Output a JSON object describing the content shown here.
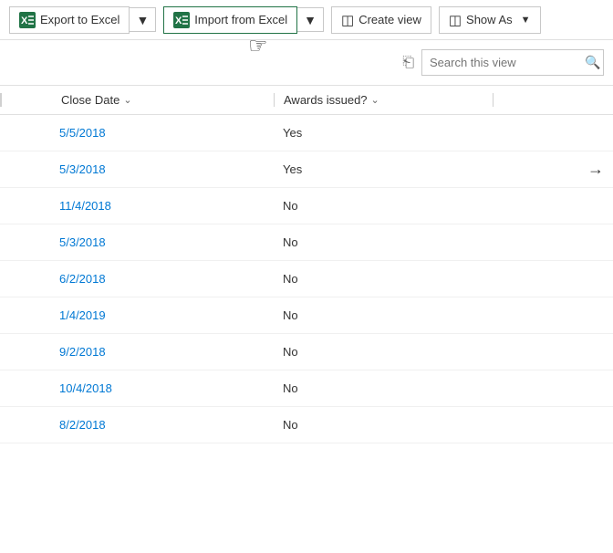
{
  "toolbar": {
    "export_label": "Export to Excel",
    "import_label": "Import from Excel",
    "create_view_label": "Create view",
    "show_as_label": "Show As"
  },
  "search": {
    "placeholder": "Search this view",
    "value": ""
  },
  "columns": {
    "close_date": "Close Date",
    "awards_issued": "Awards issued?"
  },
  "rows": [
    {
      "date": "5/5/2018",
      "award": "Yes",
      "arrow": false
    },
    {
      "date": "5/3/2018",
      "award": "Yes",
      "arrow": true
    },
    {
      "date": "11/4/2018",
      "award": "No",
      "arrow": false
    },
    {
      "date": "5/3/2018",
      "award": "No",
      "arrow": false
    },
    {
      "date": "6/2/2018",
      "award": "No",
      "arrow": false
    },
    {
      "date": "1/4/2019",
      "award": "No",
      "arrow": false
    },
    {
      "date": "9/2/2018",
      "award": "No",
      "arrow": false
    },
    {
      "date": "10/4/2018",
      "award": "No",
      "arrow": false
    },
    {
      "date": "8/2/2018",
      "award": "No",
      "arrow": false
    }
  ]
}
